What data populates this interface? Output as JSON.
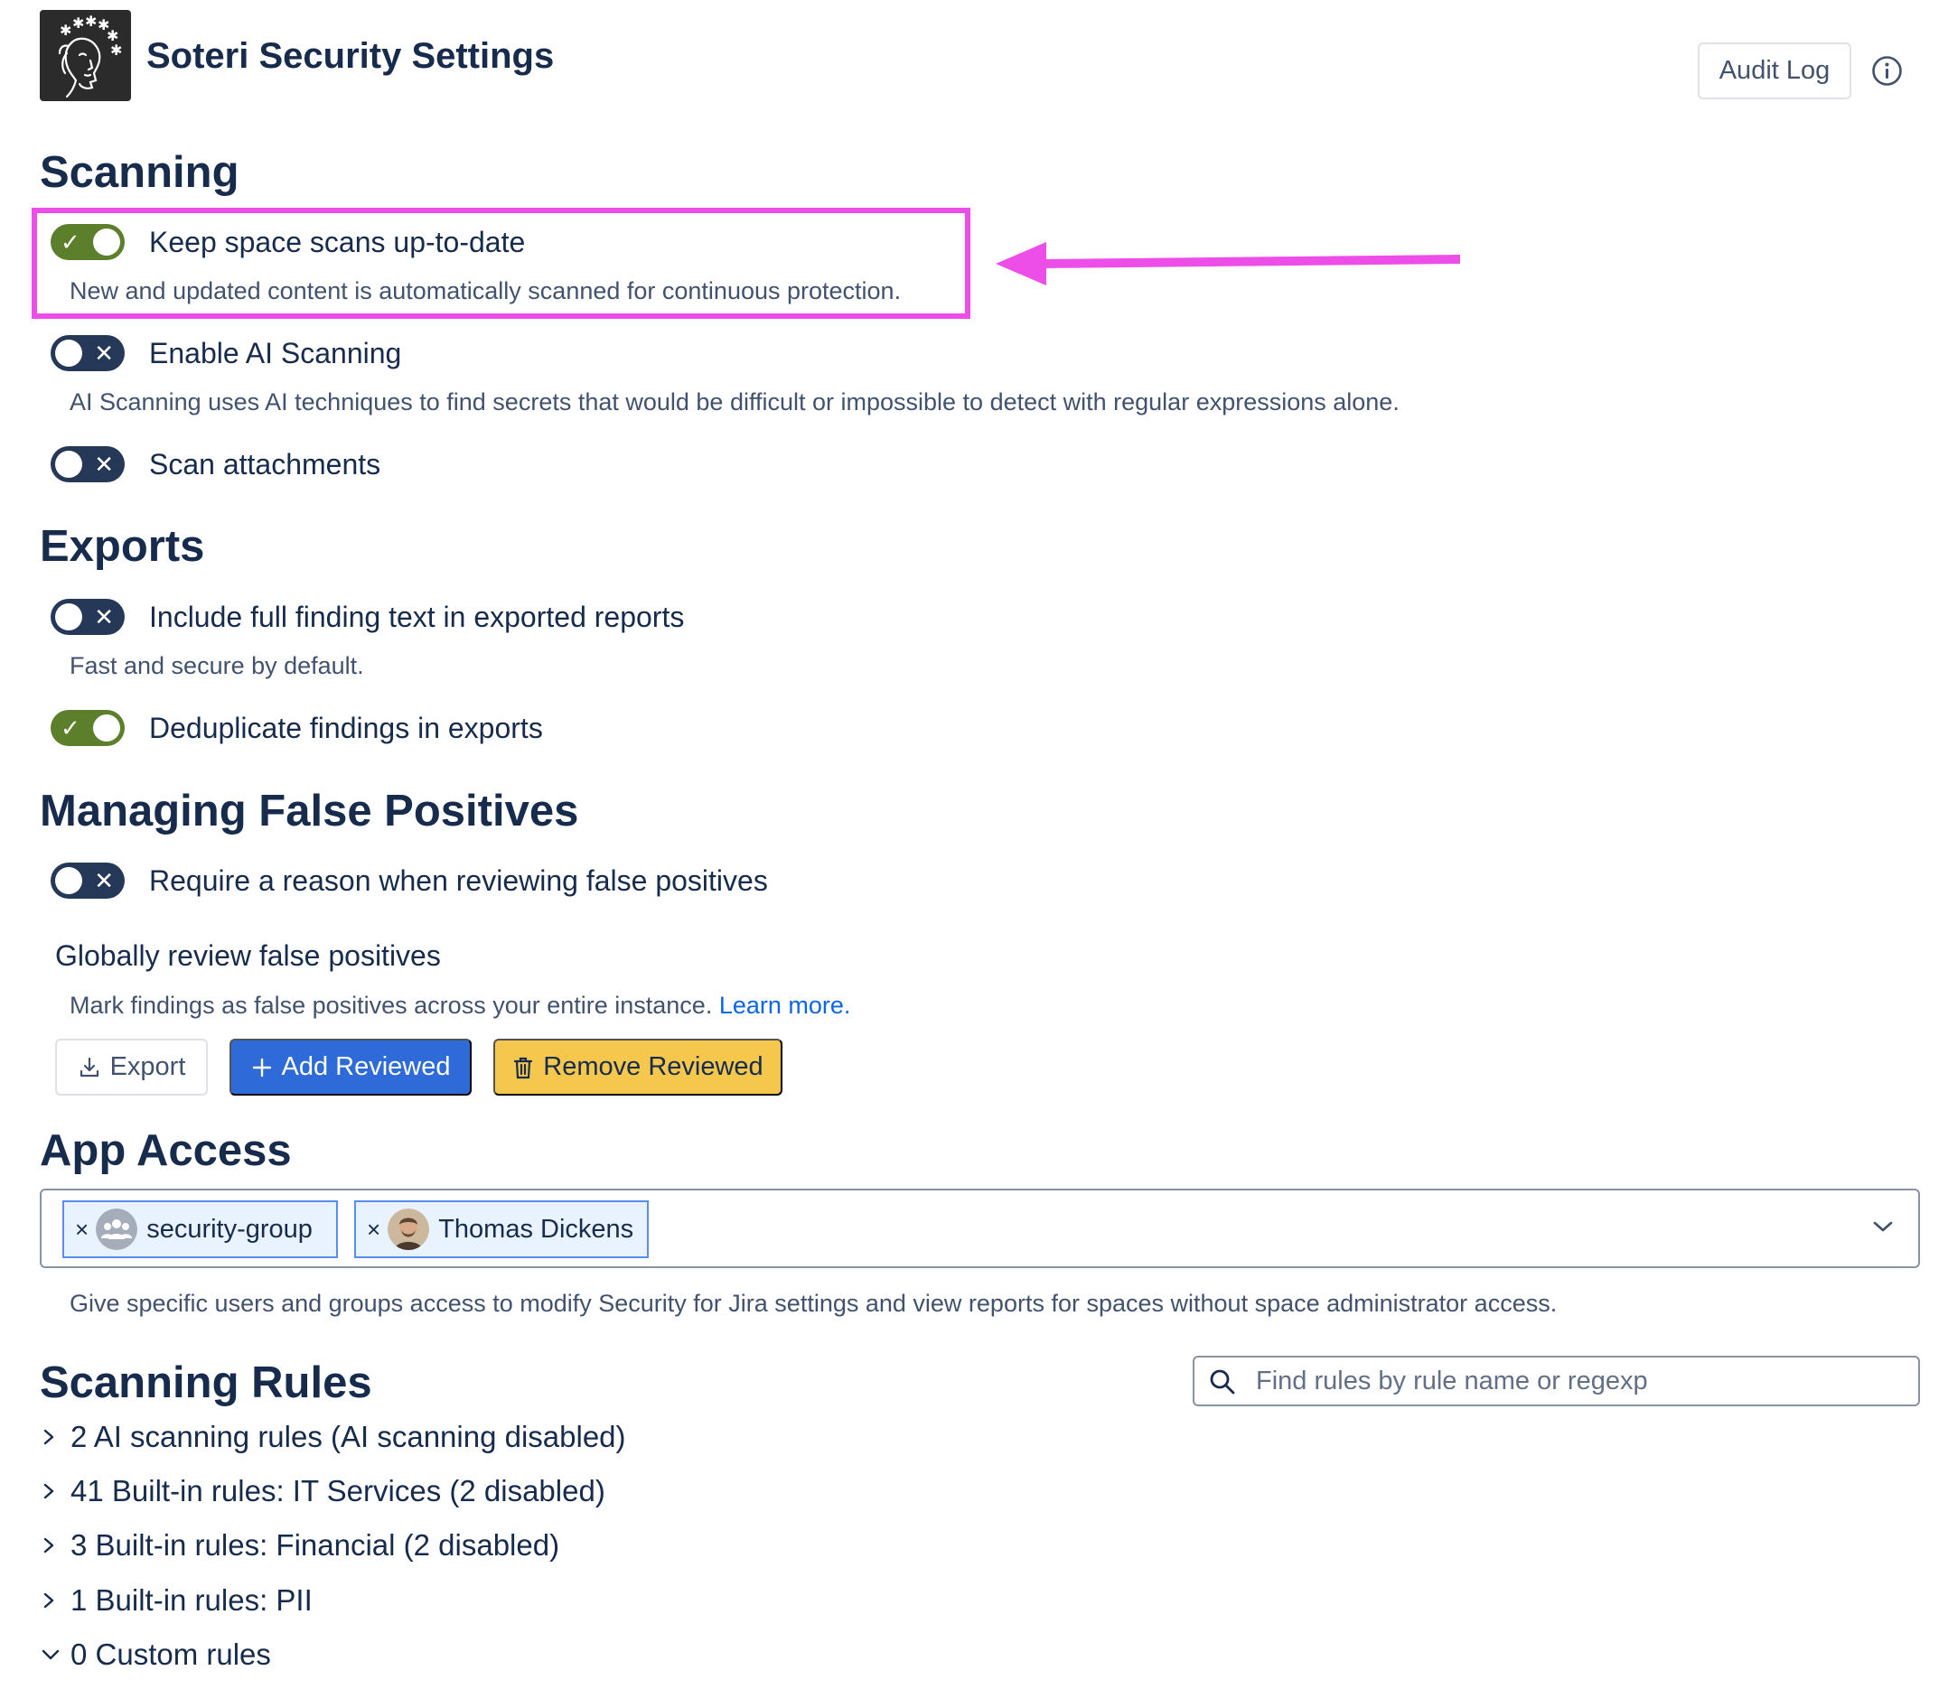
{
  "header": {
    "app_title": "Soteri Security Settings",
    "audit_log_label": "Audit Log",
    "logo_icon": "woman-face-logo-icon",
    "info_icon": "info-icon"
  },
  "scanning": {
    "heading": "Scanning",
    "items": [
      {
        "label": "Keep space scans up-to-date",
        "enabled": true,
        "description": "New and updated content is automatically scanned for continuous protection."
      },
      {
        "label": "Enable AI Scanning",
        "enabled": false,
        "description": "AI Scanning uses AI techniques to find secrets that would be difficult or impossible to detect with regular expressions alone."
      },
      {
        "label": "Scan attachments",
        "enabled": false
      }
    ]
  },
  "exports": {
    "heading": "Exports",
    "items": [
      {
        "label": "Include full finding text in exported reports",
        "enabled": false,
        "description": "Fast and secure by default."
      },
      {
        "label": "Deduplicate findings in exports",
        "enabled": true
      }
    ]
  },
  "false_positives": {
    "heading": "Managing False Positives",
    "require_reason": {
      "label": "Require a reason when reviewing false positives",
      "enabled": false
    },
    "global_review_label": "Globally review false positives",
    "global_review_description": "Mark findings as false positives across your entire instance.",
    "learn_more": "Learn more.",
    "buttons": {
      "export": "Export",
      "add_reviewed": "Add Reviewed",
      "remove_reviewed": "Remove Reviewed"
    }
  },
  "app_access": {
    "heading": "App Access",
    "chips": [
      {
        "label": "security-group",
        "avatar": "group-icon"
      },
      {
        "label": "Thomas Dickens",
        "avatar": "user-avatar"
      }
    ],
    "remove_glyph": "×",
    "description": "Give specific users and groups access to modify Security for Jira settings and view reports for spaces without space administrator access."
  },
  "scanning_rules": {
    "heading": "Scanning Rules",
    "search_placeholder": "Find rules by rule name or regexp",
    "groups": [
      {
        "label": "2 AI scanning rules (AI scanning disabled)",
        "expanded": false
      },
      {
        "label": "41 Built-in rules: IT Services (2 disabled)",
        "expanded": false
      },
      {
        "label": "3 Built-in rules: Financial (2 disabled)",
        "expanded": false
      },
      {
        "label": "1 Built-in rules: PII",
        "expanded": false
      },
      {
        "label": "0 Custom rules",
        "expanded": true
      }
    ]
  },
  "colors": {
    "toggle_on": "#5b7f2b",
    "toggle_off": "#253858",
    "primary": "#2e6bd8",
    "warning": "#f5c84d",
    "highlight_annotation": "#ee4ee8"
  }
}
